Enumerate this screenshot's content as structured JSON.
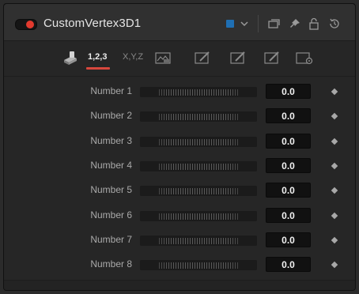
{
  "header": {
    "title": "CustomVertex3D1",
    "color_swatch": "#1f6fb3",
    "icons": [
      "chevron-down-icon",
      "versions-icon",
      "pin-icon",
      "lock-icon",
      "reset-icon"
    ]
  },
  "tabs": [
    {
      "id": "tools",
      "label": "",
      "icon": "tools-icon",
      "active": false
    },
    {
      "id": "numbers",
      "label": "1,2,3",
      "active": true
    },
    {
      "id": "positions",
      "label": "X,Y,Z",
      "active": false
    },
    {
      "id": "luts",
      "label": "",
      "icon": "lut-icon",
      "active": false
    },
    {
      "id": "setup1",
      "label": "",
      "icon": "edit-icon",
      "active": false
    },
    {
      "id": "setup2",
      "label": "",
      "icon": "edit-icon",
      "active": false
    },
    {
      "id": "setup3",
      "label": "",
      "icon": "edit-icon",
      "active": false
    },
    {
      "id": "settings",
      "label": "",
      "icon": "settings-icon",
      "active": false
    }
  ],
  "controls": [
    {
      "label": "Number 1",
      "value": "0.0"
    },
    {
      "label": "Number 2",
      "value": "0.0"
    },
    {
      "label": "Number 3",
      "value": "0.0"
    },
    {
      "label": "Number 4",
      "value": "0.0"
    },
    {
      "label": "Number 5",
      "value": "0.0"
    },
    {
      "label": "Number 6",
      "value": "0.0"
    },
    {
      "label": "Number 7",
      "value": "0.0"
    },
    {
      "label": "Number 8",
      "value": "0.0"
    }
  ],
  "colors": {
    "accent": "#d8473d",
    "toggle_on": "#e23a2e"
  }
}
